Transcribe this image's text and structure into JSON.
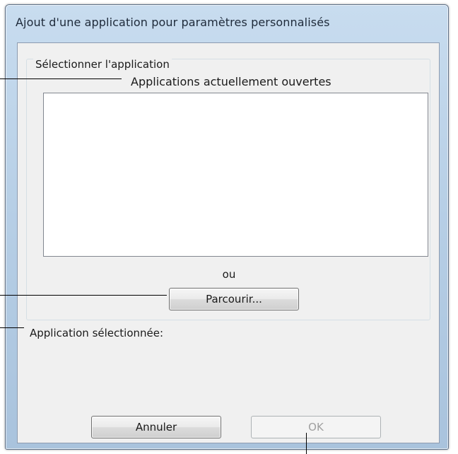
{
  "window": {
    "title": "Ajout d'une application pour paramètres personnalisés"
  },
  "select_group": {
    "title": "Sélectionner l'application",
    "open_apps_label": "Applications actuellement ouvertes",
    "open_apps": [],
    "or_label": "ou",
    "browse_label": "Parcourir..."
  },
  "selection": {
    "label": "Application sélectionnée:"
  },
  "footer": {
    "cancel_label": "Annuler",
    "ok_label": "OK",
    "ok_enabled": false
  }
}
